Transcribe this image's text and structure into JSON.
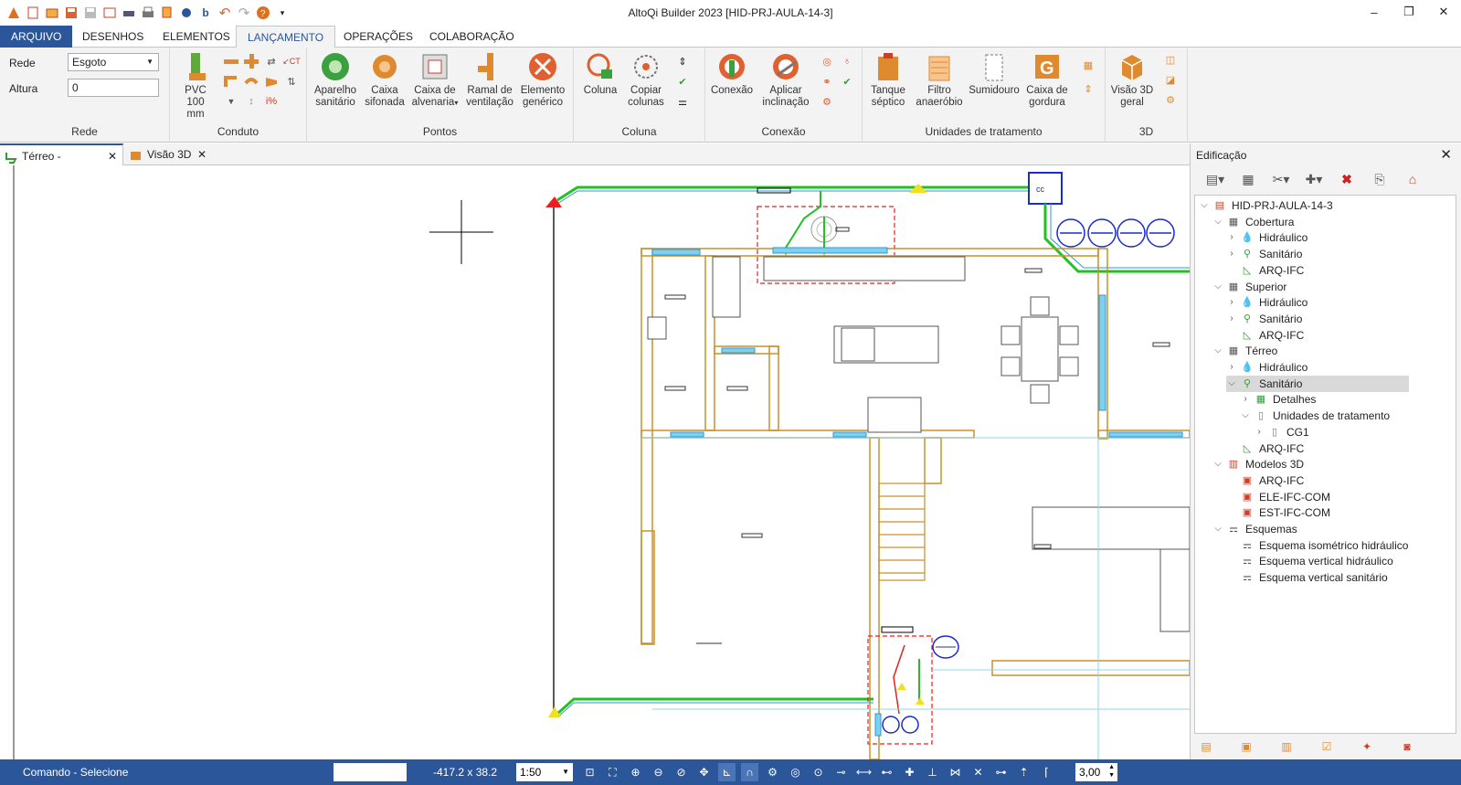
{
  "window": {
    "title": "AltoQi Builder 2023 [HID-PRJ-AULA-14-3]",
    "controls": [
      "–",
      "❐",
      "✕"
    ]
  },
  "quick_access": [
    "save-icon",
    "new-icon",
    "open-icon",
    "save-as-icon",
    "print-icon",
    "undo-icon",
    "redo-icon",
    "help-icon"
  ],
  "menu": {
    "tabs": [
      "ARQUIVO",
      "DESENHOS",
      "ELEMENTOS",
      "LANÇAMENTO",
      "OPERAÇÕES",
      "COLABORAÇÃO"
    ],
    "active": "LANÇAMENTO"
  },
  "ribbon": {
    "rede": {
      "label": "Rede",
      "rede_label": "Rede",
      "rede_value": "Esgoto",
      "altura_label": "Altura",
      "altura_value": "0"
    },
    "conduto": {
      "label": "Conduto",
      "pvc_line1": "PVC 100",
      "pvc_line2": "mm"
    },
    "pontos": {
      "label": "Pontos",
      "buttons": [
        {
          "l1": "Aparelho",
          "l2": "sanitário"
        },
        {
          "l1": "Caixa",
          "l2": "sifonada"
        },
        {
          "l1": "Caixa de",
          "l2": "alvenaria"
        },
        {
          "l1": "Ramal de",
          "l2": "ventilação"
        },
        {
          "l1": "Elemento",
          "l2": "genérico"
        }
      ]
    },
    "coluna": {
      "label": "Coluna",
      "buttons": [
        {
          "l1": "Coluna",
          "l2": ""
        },
        {
          "l1": "Copiar",
          "l2": "colunas"
        }
      ]
    },
    "conexao": {
      "label": "Conexão",
      "buttons": [
        {
          "l1": "Conexão",
          "l2": ""
        },
        {
          "l1": "Aplicar",
          "l2": "inclinação"
        }
      ]
    },
    "unidades": {
      "label": "Unidades de tratamento",
      "buttons": [
        {
          "l1": "Tanque",
          "l2": "séptico"
        },
        {
          "l1": "Filtro",
          "l2": "anaeróbio"
        },
        {
          "l1": "Sumidouro",
          "l2": ""
        },
        {
          "l1": "Caixa de",
          "l2": "gordura"
        }
      ]
    },
    "3d": {
      "label": "3D",
      "l1": "Visão 3D",
      "l2": "geral"
    }
  },
  "doc_tabs": [
    "Térreo - Sanitário",
    "Visão 3D"
  ],
  "panel": {
    "title": "Edificação",
    "tree": [
      {
        "label": "HID-PRJ-AULA-14-3",
        "level": 0,
        "chev": "v",
        "icon": "project"
      },
      {
        "label": "Cobertura",
        "level": 1,
        "chev": "v",
        "icon": "floor"
      },
      {
        "label": "Hidráulico",
        "level": 2,
        "chev": ">",
        "icon": "water"
      },
      {
        "label": "Sanitário",
        "level": 2,
        "chev": ">",
        "icon": "toilet"
      },
      {
        "label": "ARQ-IFC",
        "level": 2,
        "chev": "",
        "icon": "arq"
      },
      {
        "label": "Superior",
        "level": 1,
        "chev": "v",
        "icon": "floor"
      },
      {
        "label": "Hidráulico",
        "level": 2,
        "chev": ">",
        "icon": "water"
      },
      {
        "label": "Sanitário",
        "level": 2,
        "chev": ">",
        "icon": "toilet"
      },
      {
        "label": "ARQ-IFC",
        "level": 2,
        "chev": "",
        "icon": "arq"
      },
      {
        "label": "Térreo",
        "level": 1,
        "chev": "v",
        "icon": "floor"
      },
      {
        "label": "Hidráulico",
        "level": 2,
        "chev": ">",
        "icon": "water"
      },
      {
        "label": "Sanitário",
        "level": 2,
        "chev": "v",
        "icon": "toilet",
        "selected": true
      },
      {
        "label": "Detalhes",
        "level": 3,
        "chev": ">",
        "icon": "detail"
      },
      {
        "label": "Unidades de tratamento",
        "level": 3,
        "chev": "v",
        "icon": "tank"
      },
      {
        "label": "CG1",
        "level": 4,
        "chev": ">",
        "icon": "tank"
      },
      {
        "label": "ARQ-IFC",
        "level": 2,
        "chev": "",
        "icon": "arq"
      },
      {
        "label": "Modelos 3D",
        "level": 1,
        "chev": "v",
        "icon": "model"
      },
      {
        "label": "ARQ-IFC",
        "level": 2,
        "chev": "",
        "icon": "model3d"
      },
      {
        "label": "ELE-IFC-COM",
        "level": 2,
        "chev": "",
        "icon": "model3d"
      },
      {
        "label": "EST-IFC-COM",
        "level": 2,
        "chev": "",
        "icon": "model3d"
      },
      {
        "label": "Esquemas",
        "level": 1,
        "chev": "v",
        "icon": "scheme"
      },
      {
        "label": "Esquema isométrico hidráulico",
        "level": 2,
        "chev": "",
        "icon": "scheme"
      },
      {
        "label": "Esquema vertical hidráulico",
        "level": 2,
        "chev": "",
        "icon": "scheme"
      },
      {
        "label": "Esquema vertical sanitário",
        "level": 2,
        "chev": "",
        "icon": "scheme"
      }
    ]
  },
  "canvas": {
    "cc_label": "cc"
  },
  "status": {
    "command": "Comando - Selecione",
    "coords": "-417.2 x 38.2",
    "scale": "1:50",
    "value": "3,00"
  },
  "colors": {
    "accent": "#2b579a",
    "pipe_green": "#22c022",
    "wall_orange": "#c8902a",
    "water_blue": "#2b9ad8"
  }
}
